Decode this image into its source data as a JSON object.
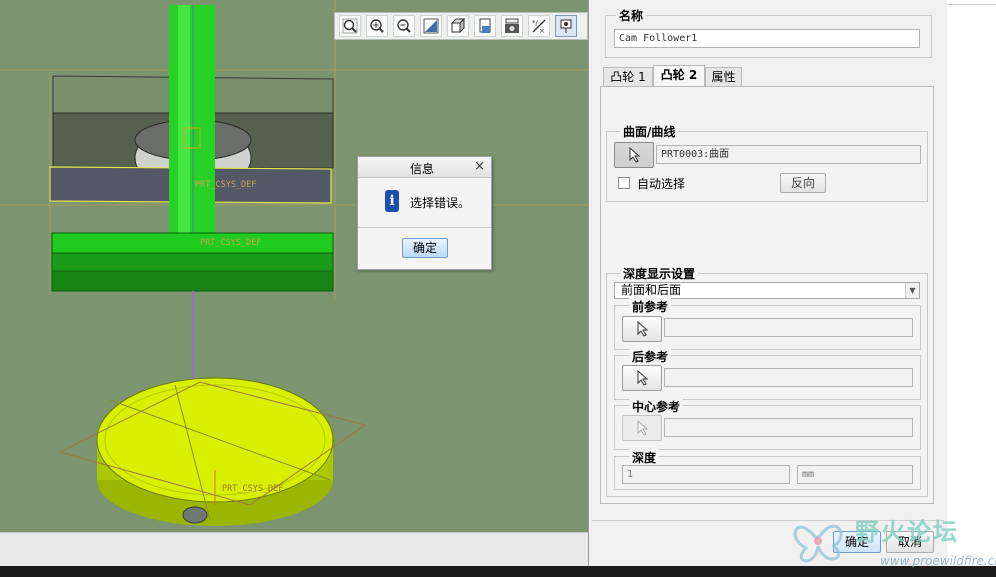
{
  "viewport": {
    "labels": {
      "top_csys": "PRT_CSYS_DEF",
      "mid_csys": "PRT_CSYS_DEF",
      "bottom_csys": "PRT_CSYS_DEF"
    },
    "toolbar": {
      "icons": [
        "zoom-fit-icon",
        "zoom-in-icon",
        "zoom-out-icon",
        "repaint-icon",
        "display-style-icon",
        "saved-views-icon",
        "camera-icon",
        "datum-display-icon",
        "spin-center-icon"
      ]
    }
  },
  "message_box": {
    "title": "信息",
    "close": "×",
    "icon": "i",
    "message": "选择错误。",
    "ok": "确定"
  },
  "panel": {
    "name_label": "名称",
    "name_value": "Cam Follower1",
    "tabs": [
      {
        "label": "凸轮 1",
        "active": false
      },
      {
        "label": "凸轮 2",
        "active": true
      },
      {
        "label": "属性",
        "active": false
      }
    ],
    "surface": {
      "label": "曲面/曲线",
      "value": "PRT0003:曲面",
      "auto_select_label": "自动选择",
      "reverse_label": "反向"
    },
    "depth": {
      "label": "深度显示设置",
      "selected": "前面和后面",
      "front_ref_label": "前参考",
      "back_ref_label": "后参考",
      "center_ref_label": "中心参考",
      "depth_label": "深度",
      "depth_value": "1",
      "depth_unit": "mm"
    },
    "ok": "确定",
    "cancel": "取消"
  },
  "watermark": {
    "text": "野火论坛",
    "url": "www.proewildfire.cn"
  }
}
